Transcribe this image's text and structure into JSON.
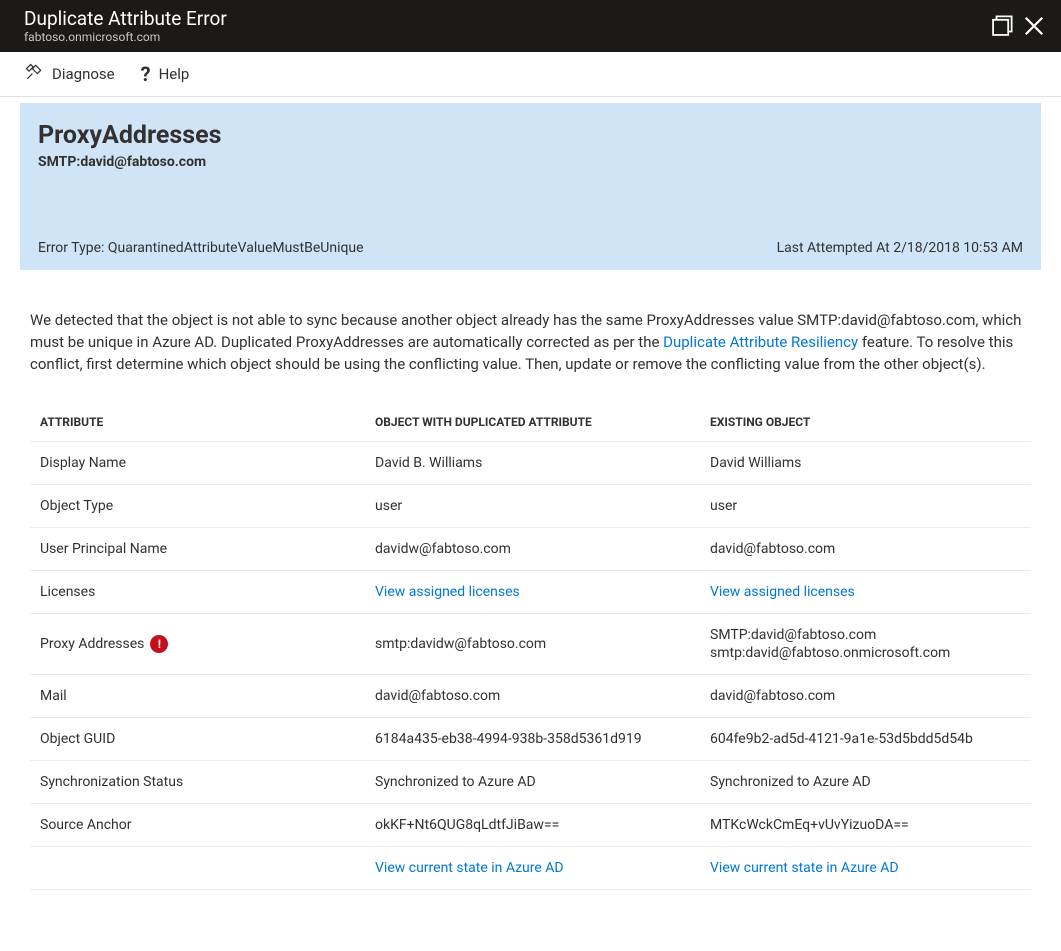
{
  "header": {
    "title": "Duplicate Attribute Error",
    "subtitle": "fabtoso.onmicrosoft.com"
  },
  "toolbar": {
    "diagnose": "Diagnose",
    "help": "Help"
  },
  "banner": {
    "attribute": "ProxyAddresses",
    "value": "SMTP:david@fabtoso.com",
    "errorTypeLabel": "Error Type: ",
    "errorType": "QuarantinedAttributeValueMustBeUnique",
    "lastLabel": "Last Attempted At ",
    "lastValue": "2/18/2018 10:53 AM"
  },
  "description": {
    "part1": "We detected that the object is not able to sync because another object already has the same ProxyAddresses value SMTP:david@fabtoso.com, which must be unique in Azure AD. Duplicated ProxyAddresses are automatically corrected as per the ",
    "link": "Duplicate Attribute Resiliency",
    "part2": " feature. To resolve this conflict, first determine which object should be using the conflicting value. Then, update or remove the conflicting value from the other object(s)."
  },
  "columns": {
    "attribute": "Attribute",
    "dup": "Object With Duplicated Attribute",
    "existing": "Existing Object"
  },
  "rows": {
    "displayName": {
      "label": "Display Name",
      "dup": "David B. Williams",
      "existing": "David Williams"
    },
    "objectType": {
      "label": "Object Type",
      "dup": "user",
      "existing": "user"
    },
    "upn": {
      "label": "User Principal Name",
      "dup": "davidw@fabtoso.com",
      "existing": "david@fabtoso.com"
    },
    "licenses": {
      "label": "Licenses",
      "dupLink": "View assigned licenses",
      "existingLink": "View assigned licenses"
    },
    "proxy": {
      "label": "Proxy Addresses",
      "dup": "smtp:davidw@fabtoso.com",
      "ex1": "SMTP:david@fabtoso.com",
      "ex2": "smtp:david@fabtoso.onmicrosoft.com"
    },
    "mail": {
      "label": "Mail",
      "dup": "david@fabtoso.com",
      "existing": "david@fabtoso.com"
    },
    "guid": {
      "label": "Object GUID",
      "dup": "6184a435-eb38-4994-938b-358d5361d919",
      "existing": "604fe9b2-ad5d-4121-9a1e-53d5bdd5d54b"
    },
    "sync": {
      "label": "Synchronization Status",
      "dup": "Synchronized to Azure AD",
      "existing": "Synchronized to Azure AD"
    },
    "anchor": {
      "label": "Source Anchor",
      "dup": "okKF+Nt6QUG8qLdtfJiBaw==",
      "existing": "MTKcWckCmEq+vUvYizuoDA=="
    },
    "view": {
      "label": "",
      "dupLink": "View current state in Azure AD",
      "existingLink": "View current state in Azure AD"
    }
  },
  "badge": "!"
}
